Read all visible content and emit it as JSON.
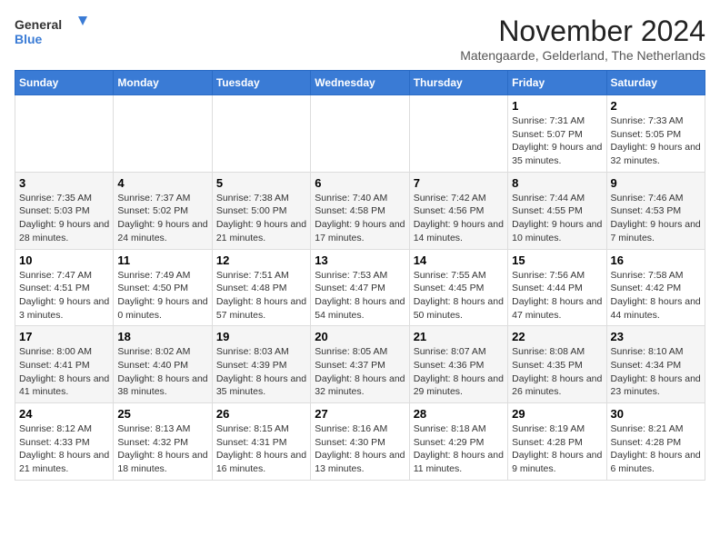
{
  "logo": {
    "line1": "General",
    "line2": "Blue"
  },
  "title": "November 2024",
  "subtitle": "Matengaarde, Gelderland, The Netherlands",
  "headers": [
    "Sunday",
    "Monday",
    "Tuesday",
    "Wednesday",
    "Thursday",
    "Friday",
    "Saturday"
  ],
  "weeks": [
    [
      {
        "day": "",
        "info": ""
      },
      {
        "day": "",
        "info": ""
      },
      {
        "day": "",
        "info": ""
      },
      {
        "day": "",
        "info": ""
      },
      {
        "day": "",
        "info": ""
      },
      {
        "day": "1",
        "info": "Sunrise: 7:31 AM\nSunset: 5:07 PM\nDaylight: 9 hours and 35 minutes."
      },
      {
        "day": "2",
        "info": "Sunrise: 7:33 AM\nSunset: 5:05 PM\nDaylight: 9 hours and 32 minutes."
      }
    ],
    [
      {
        "day": "3",
        "info": "Sunrise: 7:35 AM\nSunset: 5:03 PM\nDaylight: 9 hours and 28 minutes."
      },
      {
        "day": "4",
        "info": "Sunrise: 7:37 AM\nSunset: 5:02 PM\nDaylight: 9 hours and 24 minutes."
      },
      {
        "day": "5",
        "info": "Sunrise: 7:38 AM\nSunset: 5:00 PM\nDaylight: 9 hours and 21 minutes."
      },
      {
        "day": "6",
        "info": "Sunrise: 7:40 AM\nSunset: 4:58 PM\nDaylight: 9 hours and 17 minutes."
      },
      {
        "day": "7",
        "info": "Sunrise: 7:42 AM\nSunset: 4:56 PM\nDaylight: 9 hours and 14 minutes."
      },
      {
        "day": "8",
        "info": "Sunrise: 7:44 AM\nSunset: 4:55 PM\nDaylight: 9 hours and 10 minutes."
      },
      {
        "day": "9",
        "info": "Sunrise: 7:46 AM\nSunset: 4:53 PM\nDaylight: 9 hours and 7 minutes."
      }
    ],
    [
      {
        "day": "10",
        "info": "Sunrise: 7:47 AM\nSunset: 4:51 PM\nDaylight: 9 hours and 3 minutes."
      },
      {
        "day": "11",
        "info": "Sunrise: 7:49 AM\nSunset: 4:50 PM\nDaylight: 9 hours and 0 minutes."
      },
      {
        "day": "12",
        "info": "Sunrise: 7:51 AM\nSunset: 4:48 PM\nDaylight: 8 hours and 57 minutes."
      },
      {
        "day": "13",
        "info": "Sunrise: 7:53 AM\nSunset: 4:47 PM\nDaylight: 8 hours and 54 minutes."
      },
      {
        "day": "14",
        "info": "Sunrise: 7:55 AM\nSunset: 4:45 PM\nDaylight: 8 hours and 50 minutes."
      },
      {
        "day": "15",
        "info": "Sunrise: 7:56 AM\nSunset: 4:44 PM\nDaylight: 8 hours and 47 minutes."
      },
      {
        "day": "16",
        "info": "Sunrise: 7:58 AM\nSunset: 4:42 PM\nDaylight: 8 hours and 44 minutes."
      }
    ],
    [
      {
        "day": "17",
        "info": "Sunrise: 8:00 AM\nSunset: 4:41 PM\nDaylight: 8 hours and 41 minutes."
      },
      {
        "day": "18",
        "info": "Sunrise: 8:02 AM\nSunset: 4:40 PM\nDaylight: 8 hours and 38 minutes."
      },
      {
        "day": "19",
        "info": "Sunrise: 8:03 AM\nSunset: 4:39 PM\nDaylight: 8 hours and 35 minutes."
      },
      {
        "day": "20",
        "info": "Sunrise: 8:05 AM\nSunset: 4:37 PM\nDaylight: 8 hours and 32 minutes."
      },
      {
        "day": "21",
        "info": "Sunrise: 8:07 AM\nSunset: 4:36 PM\nDaylight: 8 hours and 29 minutes."
      },
      {
        "day": "22",
        "info": "Sunrise: 8:08 AM\nSunset: 4:35 PM\nDaylight: 8 hours and 26 minutes."
      },
      {
        "day": "23",
        "info": "Sunrise: 8:10 AM\nSunset: 4:34 PM\nDaylight: 8 hours and 23 minutes."
      }
    ],
    [
      {
        "day": "24",
        "info": "Sunrise: 8:12 AM\nSunset: 4:33 PM\nDaylight: 8 hours and 21 minutes."
      },
      {
        "day": "25",
        "info": "Sunrise: 8:13 AM\nSunset: 4:32 PM\nDaylight: 8 hours and 18 minutes."
      },
      {
        "day": "26",
        "info": "Sunrise: 8:15 AM\nSunset: 4:31 PM\nDaylight: 8 hours and 16 minutes."
      },
      {
        "day": "27",
        "info": "Sunrise: 8:16 AM\nSunset: 4:30 PM\nDaylight: 8 hours and 13 minutes."
      },
      {
        "day": "28",
        "info": "Sunrise: 8:18 AM\nSunset: 4:29 PM\nDaylight: 8 hours and 11 minutes."
      },
      {
        "day": "29",
        "info": "Sunrise: 8:19 AM\nSunset: 4:28 PM\nDaylight: 8 hours and 9 minutes."
      },
      {
        "day": "30",
        "info": "Sunrise: 8:21 AM\nSunset: 4:28 PM\nDaylight: 8 hours and 6 minutes."
      }
    ]
  ]
}
